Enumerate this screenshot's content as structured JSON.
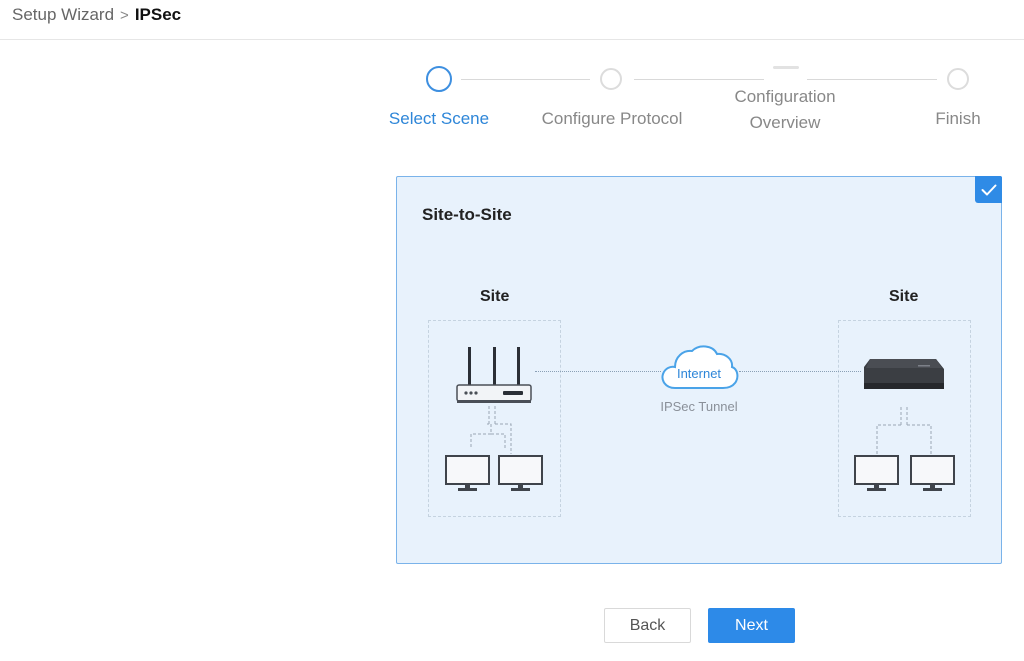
{
  "breadcrumb": {
    "parent": "Setup Wizard",
    "separator": ">",
    "current": "IPSec"
  },
  "steps": [
    {
      "label": "Select Scene",
      "state": "active"
    },
    {
      "label": "Configure Protocol",
      "state": "pending"
    },
    {
      "label_line1": "Configuration",
      "label_line2": "Overview",
      "state": "pending"
    },
    {
      "label": "Finish",
      "state": "pending"
    }
  ],
  "scene": {
    "title": "Site-to-Site",
    "selected": true,
    "left_site_label": "Site",
    "right_site_label": "Site",
    "cloud_label": "Internet",
    "tunnel_label": "IPSec Tunnel"
  },
  "buttons": {
    "back": "Back",
    "next": "Next"
  },
  "colors": {
    "accent": "#2d8ae8",
    "card_bg": "#e8f2fc",
    "card_border": "#7ab3ea"
  },
  "icons": [
    "check-icon",
    "router-icon",
    "gateway-device-icon",
    "cloud-icon",
    "monitor-icon"
  ]
}
